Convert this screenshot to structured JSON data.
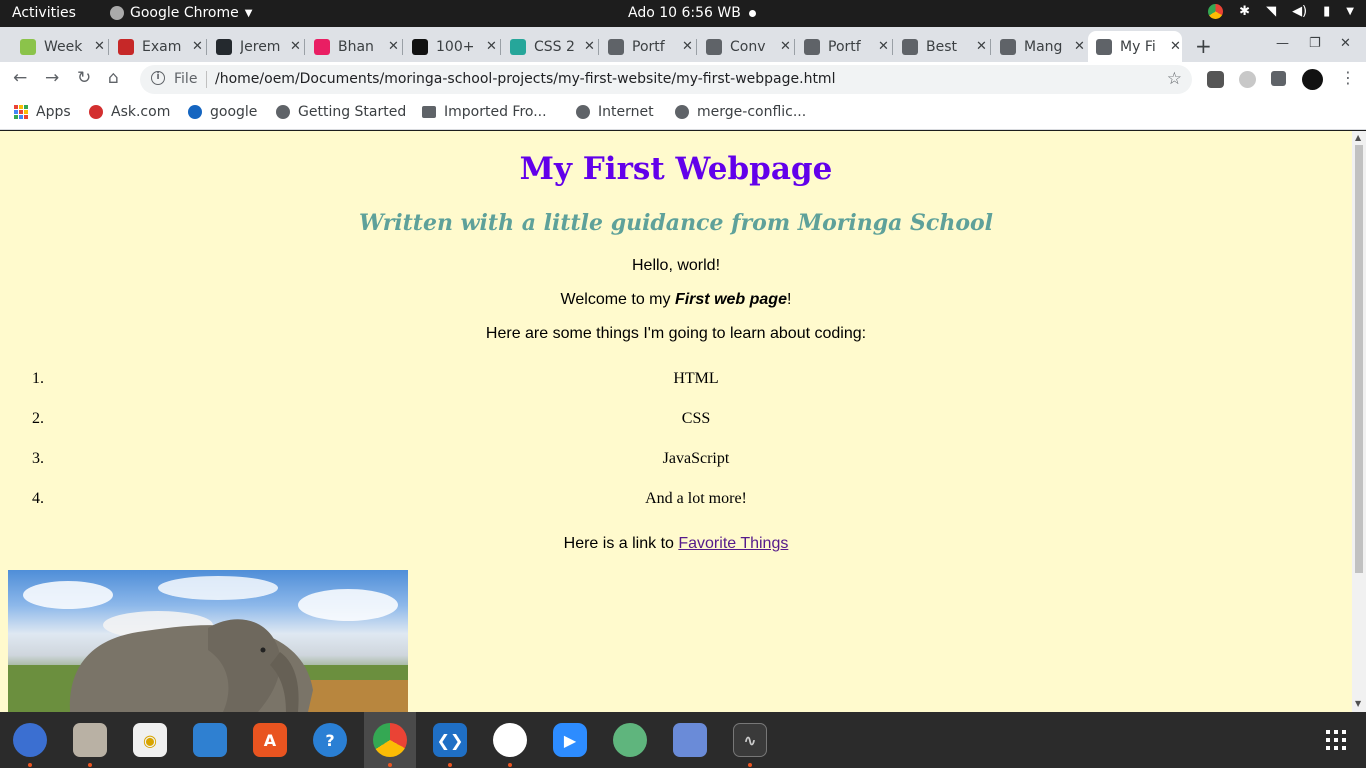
{
  "topbar": {
    "activities": "Activities",
    "app_name": "Google Chrome",
    "clock": "Ado 10  6:56 WB"
  },
  "tabs": [
    {
      "title": "Week",
      "color": "#8bc34a"
    },
    {
      "title": "Exam",
      "color": "#c62828"
    },
    {
      "title": "Jerem",
      "color": "#24292e"
    },
    {
      "title": "Bhan",
      "color": "#e91e63"
    },
    {
      "title": "100+",
      "color": "#111111"
    },
    {
      "title": "CSS 2",
      "color": "#26a69a"
    },
    {
      "title": "Portf",
      "color": "#5f6368"
    },
    {
      "title": "Conv",
      "color": "#5f6368"
    },
    {
      "title": "Portf",
      "color": "#5f6368"
    },
    {
      "title": "Best",
      "color": "#5f6368"
    },
    {
      "title": "Mang",
      "color": "#5f6368"
    },
    {
      "title": "My Fi",
      "color": "#5f6368",
      "active": true
    }
  ],
  "toolbar": {
    "file_label": "File",
    "url": "/home/oem/Documents/moringa-school-projects/my-first-website/my-first-webpage.html"
  },
  "bookmarks": [
    {
      "label": "Apps"
    },
    {
      "label": "Ask.com",
      "color": "#d32f2f"
    },
    {
      "label": "google",
      "color": "#1565c0"
    },
    {
      "label": "Getting Started",
      "color": "#5f6368"
    },
    {
      "label": "Imported Fro...",
      "color": "#5f6368"
    },
    {
      "label": "Internet",
      "color": "#5f6368"
    },
    {
      "label": "merge-conflic...",
      "color": "#5f6368"
    }
  ],
  "page": {
    "heading": "My First Webpage",
    "subheading": "Written with a little guidance from Moringa School",
    "hello": "Hello, world!",
    "welcome_prefix": "Welcome to my ",
    "welcome_emph": "First web page",
    "welcome_suffix": "!",
    "learn_intro": "Here are some things I'm going to learn about coding:",
    "list": [
      {
        "num": "1.",
        "text": "HTML"
      },
      {
        "num": "2.",
        "text": "CSS"
      },
      {
        "num": "3.",
        "text": "JavaScript"
      },
      {
        "num": "4.",
        "text": "And a lot more!"
      }
    ],
    "link_prefix": "Here is a link to ",
    "link_text": "Favorite Things",
    "background": "#fffacd",
    "heading_color": "#6200ea",
    "subheading_color": "#5ea19a",
    "link_color": "#551a8b"
  },
  "dock": {
    "apps": [
      "thunderbird",
      "files",
      "rhythmbox",
      "writer",
      "software",
      "help",
      "chrome",
      "vscode",
      "slack",
      "zoom",
      "atom",
      "screenshot",
      "system-monitor"
    ]
  }
}
